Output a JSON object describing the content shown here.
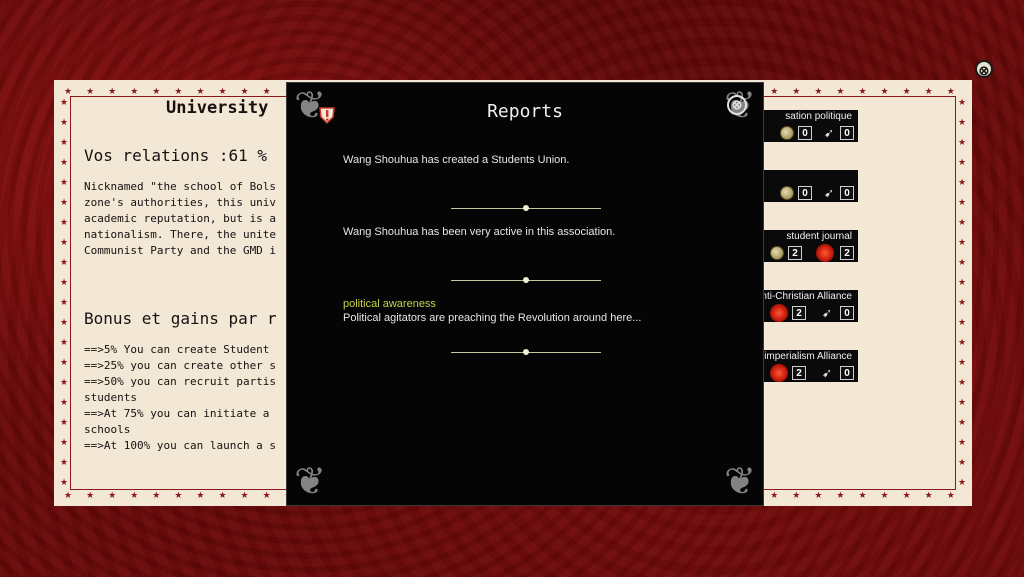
{
  "university": {
    "title": "University",
    "relations": "Vos relations :61 %",
    "description": "Nicknamed \"the school of Bols\nzone's authorities, this univ\nacademic reputation, but is a\nnationalism. There, the unite\nCommunist Party and the GMD i",
    "bonus_title": "Bonus et gains par r",
    "bonus_lines": "==>5% You can create Student\n==>25% you can create other s\n==>50% you can recruit partis\nstudents\n==>At 75% you can initiate a\nschools\n==>At 100% you can launch a s"
  },
  "associations": [
    {
      "name": "sation politique",
      "left": {
        "icon": "coin-icon",
        "value": "0"
      },
      "right": {
        "icon": "bird-icon",
        "value": "0"
      }
    },
    {
      "name": "",
      "left": {
        "icon": "coin-icon",
        "value": "0"
      },
      "right": {
        "icon": "bird-icon",
        "value": "0"
      }
    },
    {
      "name": "student journal",
      "left": {
        "icon": "coin-icon",
        "value": "2"
      },
      "right": {
        "icon": "fist-icon",
        "value": "2"
      }
    },
    {
      "name": "nti-Christian Alliance",
      "left": {
        "icon": "fist-icon",
        "value": "2"
      },
      "right": {
        "icon": "bird-icon",
        "value": "0"
      }
    },
    {
      "name": "ti-imperialism Alliance",
      "left": {
        "icon": "fist-icon",
        "value": "2"
      },
      "right": {
        "icon": "bird-icon",
        "value": "0"
      }
    }
  ],
  "reports": {
    "title": "Reports",
    "items": [
      {
        "category": "",
        "text": "Wang Shouhua has created a Students Union."
      },
      {
        "category": "",
        "text": "Wang Shouhua has been very active in this association."
      },
      {
        "category": "political awareness",
        "text": "Political agitators are preaching the Revolution around here..."
      }
    ]
  },
  "close_glyph": "⊗",
  "colors": {
    "accent_category": "#c8d24a",
    "panel_bg": "#f3e7d6",
    "border_red": "#8a1a1a"
  }
}
